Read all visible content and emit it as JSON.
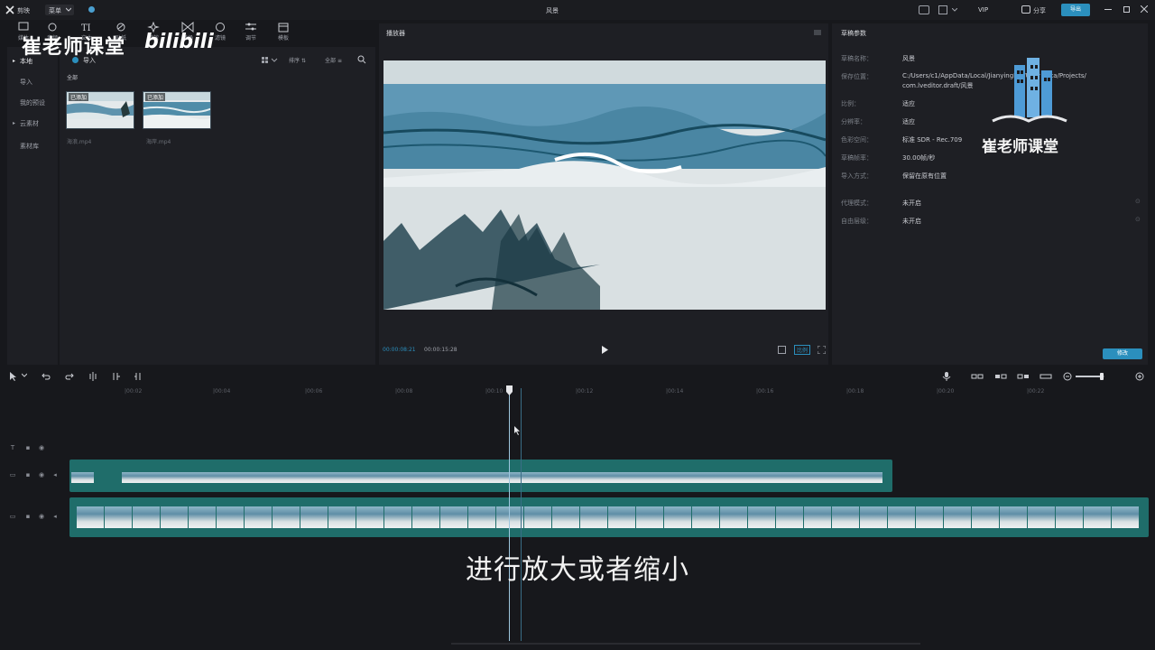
{
  "app": {
    "logo_label": "剪映",
    "menu_label": "菜单",
    "window_title": "风景",
    "vip_label": "VIP",
    "share_label": "分享",
    "export_label": "导出"
  },
  "topnav": {
    "items": [
      {
        "label": "媒体",
        "icon": "media-icon"
      },
      {
        "label": "音频",
        "icon": "audio-icon"
      },
      {
        "label": "文本",
        "icon": "text-icon"
      },
      {
        "label": "贴纸",
        "icon": "sticker-icon"
      },
      {
        "label": "特效",
        "icon": "effects-icon"
      },
      {
        "label": "转场",
        "icon": "transition-icon"
      },
      {
        "label": "滤镜",
        "icon": "filter-icon"
      },
      {
        "label": "调节",
        "icon": "adjust-icon"
      },
      {
        "label": "模板",
        "icon": "template-icon"
      }
    ]
  },
  "sidebar": {
    "items": [
      {
        "label": "本地",
        "active": true
      },
      {
        "label": "导入",
        "active": false
      },
      {
        "label": "我的预设",
        "active": false
      },
      {
        "label": "云素材",
        "active": false
      },
      {
        "label": "素材库",
        "active": false
      }
    ]
  },
  "media": {
    "import_label": "导入",
    "sort_label": "排序",
    "filter_label": "全部",
    "section_label": "全部",
    "items": [
      {
        "tag": "已添加",
        "name": "海浪.mp4"
      },
      {
        "tag": "已添加",
        "name": "海岸.mp4"
      }
    ]
  },
  "watermark": {
    "left_text": "崔老师课堂",
    "bili_text": "bilibili",
    "right_text": "崔老师课堂"
  },
  "player": {
    "title": "播放器",
    "current_time": "00:00:08:21",
    "total_time": "00:00:15:28",
    "ratio_label": "比例"
  },
  "draft": {
    "title": "草稿参数",
    "rows": [
      {
        "key": "草稿名称：",
        "value": "风景"
      },
      {
        "key": "保存位置：",
        "value": "C:/Users/c1/AppData/Local/JianyingPro/User Data/Projects/"
      },
      {
        "key": "",
        "value": "com.lveditor.draft/风景"
      },
      {
        "key": "比例：",
        "value": "适应"
      },
      {
        "key": "分辨率：",
        "value": "适应"
      },
      {
        "key": "色彩空间：",
        "value": "标准 SDR - Rec.709"
      },
      {
        "key": "草稿帧率：",
        "value": "30.00帧/秒"
      },
      {
        "key": "导入方式：",
        "value": "保留在原有位置"
      },
      {
        "key": "代理模式：",
        "value": "未开启"
      },
      {
        "key": "自由层级：",
        "value": "未开启"
      }
    ],
    "modify_label": "修改"
  },
  "timeline": {
    "ruler_labels": [
      "00:00",
      "|00:02",
      "|00:04",
      "|00:06",
      "|00:08",
      "|00:10",
      "|00:12",
      "|00:14",
      "|00:16",
      "|00:18",
      "|00:20",
      "|00:22"
    ]
  },
  "subtitle": "进行放大或者缩小",
  "colors": {
    "accent": "#2b8fbd",
    "clip": "#1f6d6a",
    "playhead": "#9fc7df"
  }
}
